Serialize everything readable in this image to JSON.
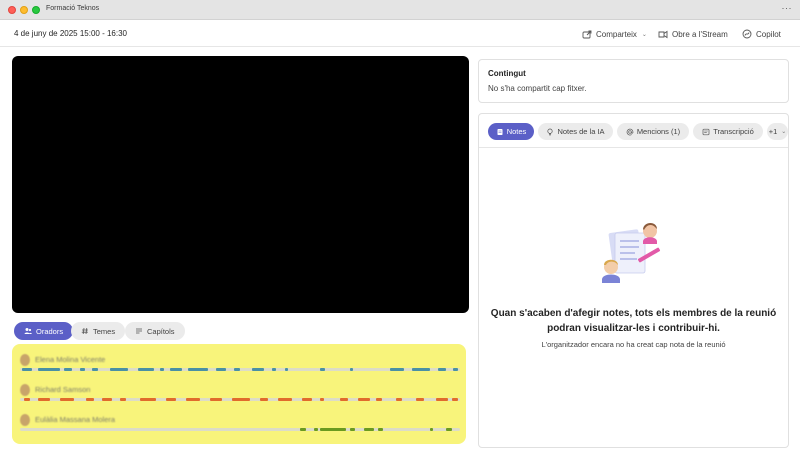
{
  "window": {
    "title": "Formació Teknos",
    "more_label": "···"
  },
  "header": {
    "date": "4 de juny de 2025 15:00 - 16:30",
    "share_label": "Comparteix",
    "stream_label": "Obre a l'Stream",
    "copilot_label": "Copilot"
  },
  "video_tabs": [
    {
      "label": "Oradors",
      "icon": "people-icon",
      "active": true
    },
    {
      "label": "Temes",
      "icon": "hashtag-icon",
      "active": false
    },
    {
      "label": "Capítols",
      "icon": "list-icon",
      "active": false
    }
  ],
  "speakers": [
    {
      "name": "Elena Molina Vicente",
      "color": "#4a90a4"
    },
    {
      "name": "Richard Samson",
      "color": "#e06b2c"
    },
    {
      "name": "Eulàlia Massana Molera",
      "color": "#6a9a1f"
    }
  ],
  "content": {
    "title": "Contingut",
    "empty": "No s'ha compartit cap fitxer."
  },
  "notes_tabs": [
    {
      "label": "Notes",
      "icon": "notes-icon",
      "active": true
    },
    {
      "label": "Notes de la IA",
      "icon": "lightbulb-icon",
      "active": false
    },
    {
      "label": "Mencions (1)",
      "icon": "at-icon",
      "active": false
    },
    {
      "label": "Transcripció",
      "icon": "transcript-icon",
      "active": false
    },
    {
      "label": "+1",
      "icon": "chevron-down-icon",
      "active": false
    }
  ],
  "notes_empty": {
    "title": "Quan s'acaben d'afegir notes, tots els membres de la reunió podran visualitzar-les i contribuir-hi.",
    "subtitle": "L'organitzador encara no ha creat cap nota de la reunió"
  },
  "colors": {
    "accent": "#5b5fc7",
    "highlight": "#f8f47b"
  }
}
